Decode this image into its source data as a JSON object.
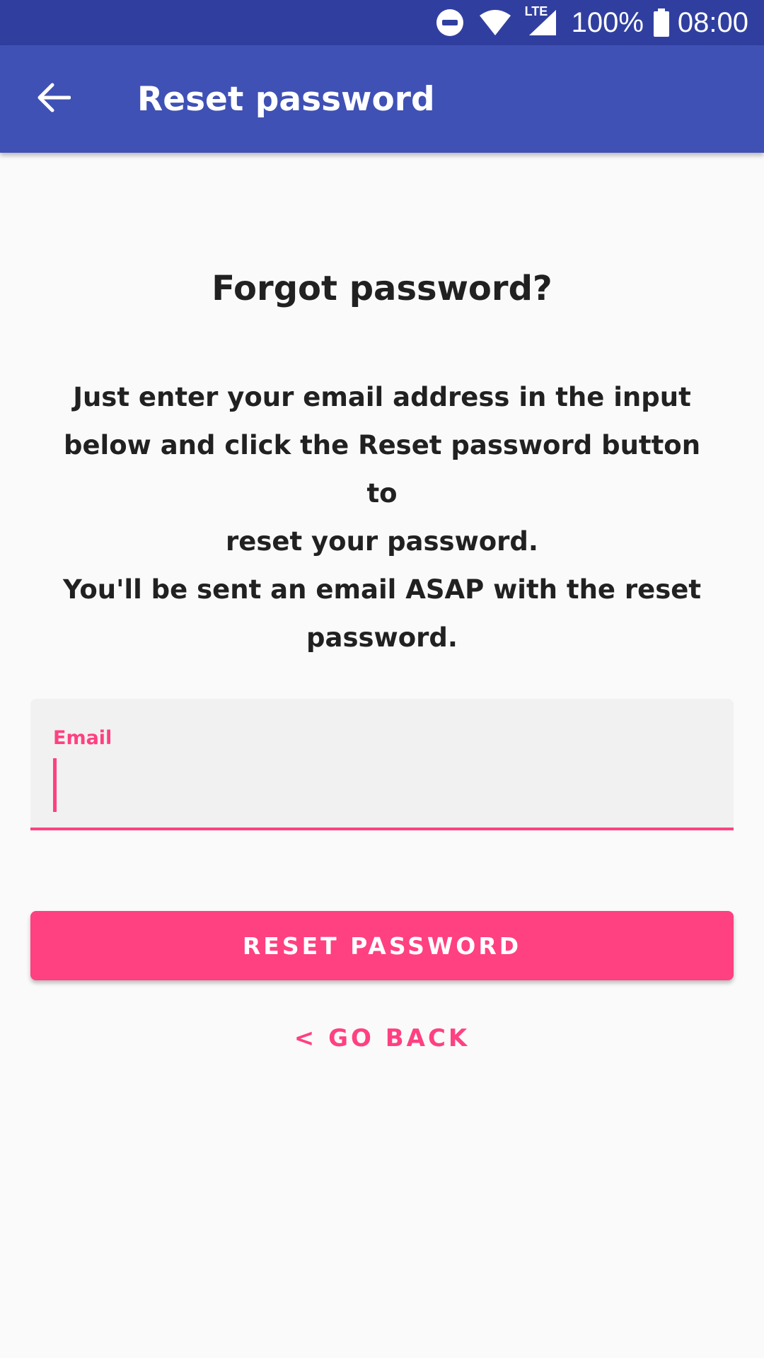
{
  "status_bar": {
    "icons": [
      "do-not-disturb-icon",
      "wifi-icon",
      "lte-signal-icon",
      "battery-icon"
    ],
    "lte_label": "LTE",
    "battery_percent": "100%",
    "time": "08:00"
  },
  "app_bar": {
    "back_icon": "arrow-left-icon",
    "title": "Reset password",
    "color": "#3f51b5",
    "status_color": "#303f9f"
  },
  "main": {
    "heading": "Forgot password?",
    "description_lines": [
      "Just enter your email address in the input",
      "below and click the Reset password button to",
      "reset your password.",
      "You'll be sent an email ASAP with the reset",
      "password."
    ],
    "email_field": {
      "label": "Email",
      "value": "",
      "accent_color": "#ff4081"
    },
    "reset_button_label": "RESET PASSWORD",
    "go_back_label": "< GO BACK"
  }
}
